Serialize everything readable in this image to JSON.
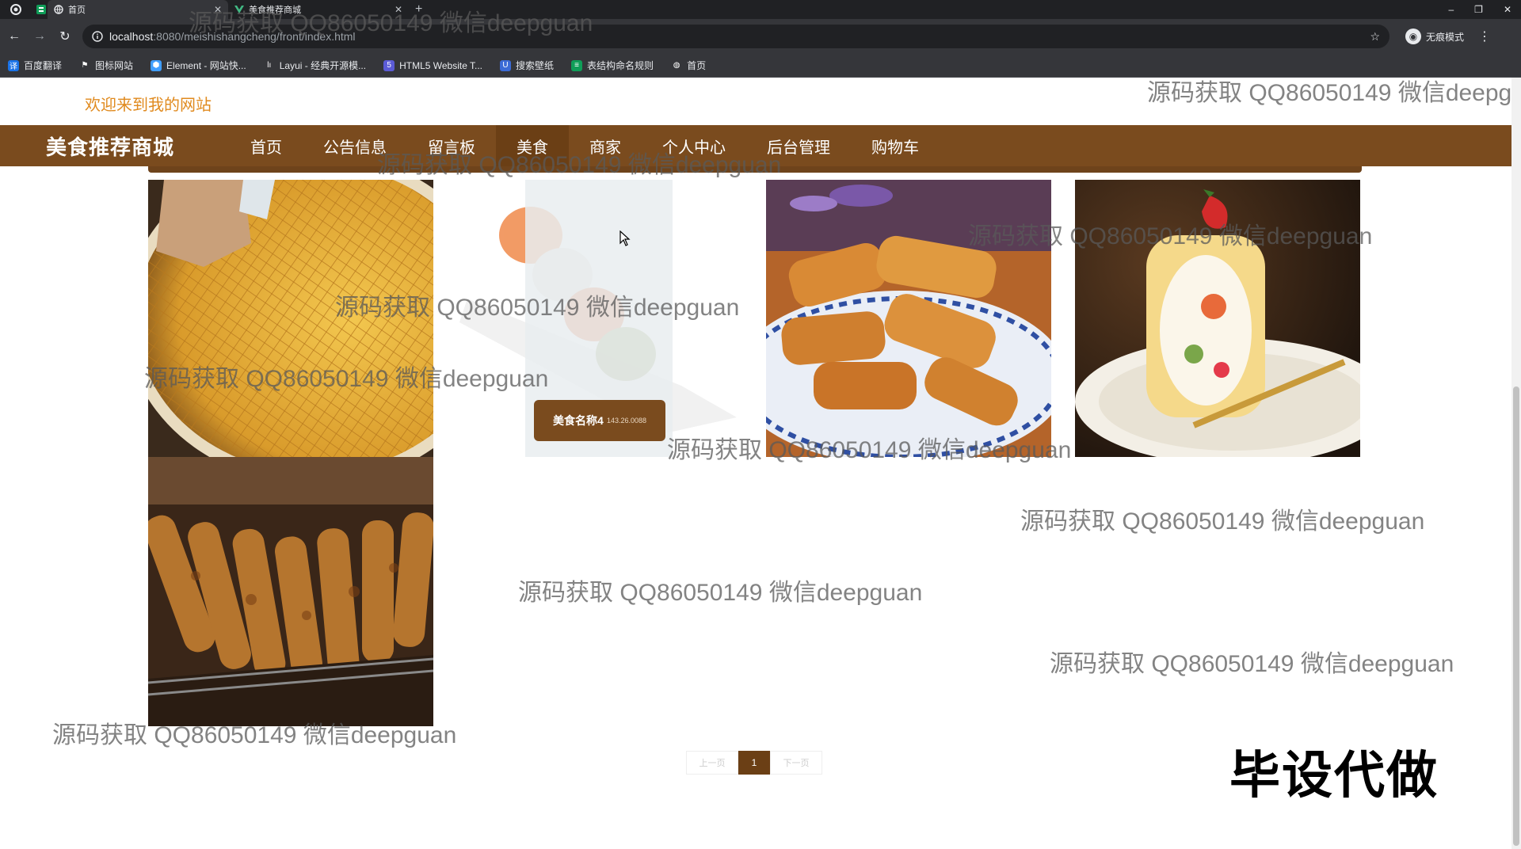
{
  "browser": {
    "tabs": [
      {
        "title": "首页",
        "active": true
      },
      {
        "title": "美食推荐商城",
        "active": false
      }
    ],
    "new_tab": "+",
    "window_controls": [
      "–",
      "❐",
      "✕"
    ],
    "url_host": "localhost",
    "url_path": ":8080/meishishangcheng/front/index.html",
    "profile_label": "无痕模式",
    "bookmarks": [
      {
        "label": "百度翻译",
        "color": "#1a73e8",
        "icon": "translate-icon"
      },
      {
        "label": "图标网站",
        "color": "#202124",
        "icon": "flag-icon"
      },
      {
        "label": "Element - 网站快...",
        "color": "#409eff",
        "icon": "element-icon"
      },
      {
        "label": "Layui - 经典开源模...",
        "color": "#444",
        "icon": "layui-icon"
      },
      {
        "label": "HTML5 Website T...",
        "color": "#5b5bd6",
        "icon": "html5-icon"
      },
      {
        "label": "搜索壁纸",
        "color": "#3b6bd6",
        "icon": "wallpaper-icon"
      },
      {
        "label": "表结构命名规则",
        "color": "#0f9d58",
        "icon": "sheet-icon"
      },
      {
        "label": "首页",
        "color": "#202124",
        "icon": "globe-icon"
      }
    ]
  },
  "site": {
    "welcome": "欢迎来到我的网站",
    "brand": "美食推荐商城",
    "nav": [
      {
        "label": "首页",
        "active": false
      },
      {
        "label": "公告信息",
        "active": false
      },
      {
        "label": "留言板",
        "active": false
      },
      {
        "label": "美食",
        "active": true
      },
      {
        "label": "商家",
        "active": false
      },
      {
        "label": "个人中心",
        "active": false
      },
      {
        "label": "后台管理",
        "active": false
      },
      {
        "label": "购物车",
        "active": false
      }
    ],
    "overlay": {
      "name": "美食名称4",
      "sub": "143.26.0088"
    },
    "pager": {
      "prev": "上一页",
      "current": "1",
      "next": "下一页"
    }
  },
  "watermarks": [
    "源码获取 QQ86050149 微信deepguan"
  ],
  "promo": "毕设代做"
}
